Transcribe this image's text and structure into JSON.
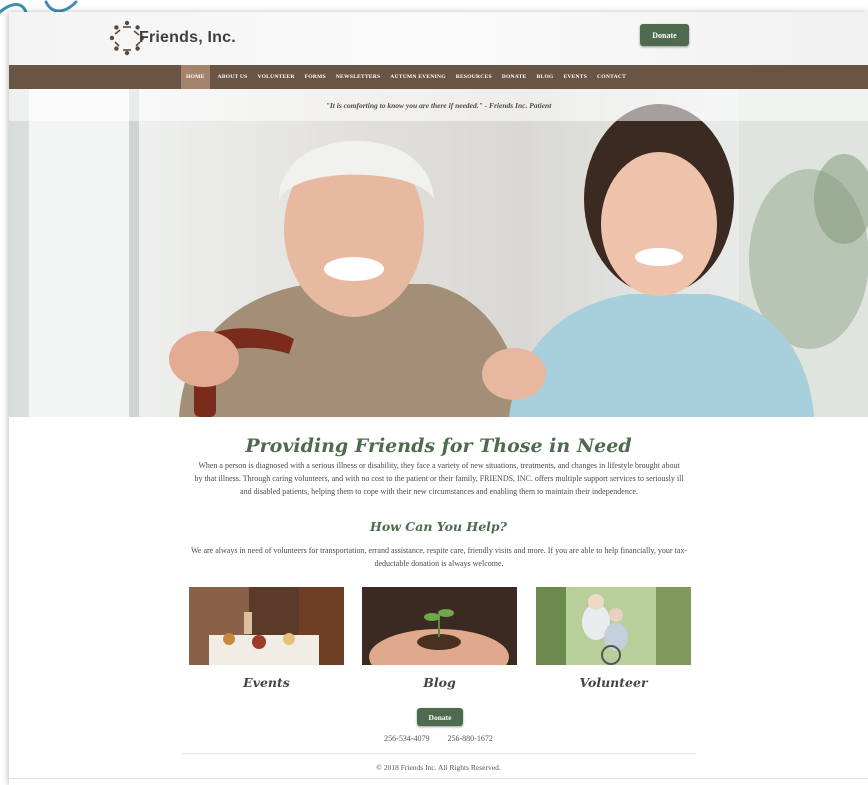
{
  "site": {
    "logo_text": "Friends, Inc.",
    "donate_label": "Donate"
  },
  "nav": {
    "items": [
      "HOME",
      "ABOUT US",
      "VOLUNTEER",
      "FORMS",
      "NEWSLETTERS",
      "AUTUMN EVENING",
      "RESOURCES",
      "DONATE",
      "BLOG",
      "EVENTS",
      "CONTACT"
    ],
    "active": "HOME"
  },
  "hero": {
    "quote": "\"It is comforting to know you are there if needed.\"  -  Friends Inc. Patient"
  },
  "main": {
    "heading": "Providing Friends for Those in Need",
    "intro": "When a person is diagnosed with a serious illness or disability, they face a variety of new situations, treatments, and changes in lifestyle brought about by that illness. Through caring volunteers, and with no cost to the patient or their family, FRIENDS, INC. offers multiple support services to seriously ill and disabled patients, helping them to cope with their new circumstances and enabling them to maintain their independence.",
    "help_heading": "How Can You Help?",
    "help_text": "We are always in need of volunteers for transportation, errand assistance, respite care, friendly visits and more. If you are able to help financially, your tax-deductable donation is always welcome."
  },
  "cards": [
    {
      "label": "Events"
    },
    {
      "label": "Blog"
    },
    {
      "label": "Volunteer"
    }
  ],
  "footer": {
    "donate_label": "Donate",
    "phone1": "256-534-4079",
    "phone2": "256-880-1672",
    "copyright": "© 2018 Friends Inc. All Rights Reserved."
  },
  "colors": {
    "nav_bg": "#6a5444",
    "nav_active": "#a4836a",
    "accent_green": "#4e6b4e",
    "swoosh": "#3e8fb0"
  }
}
